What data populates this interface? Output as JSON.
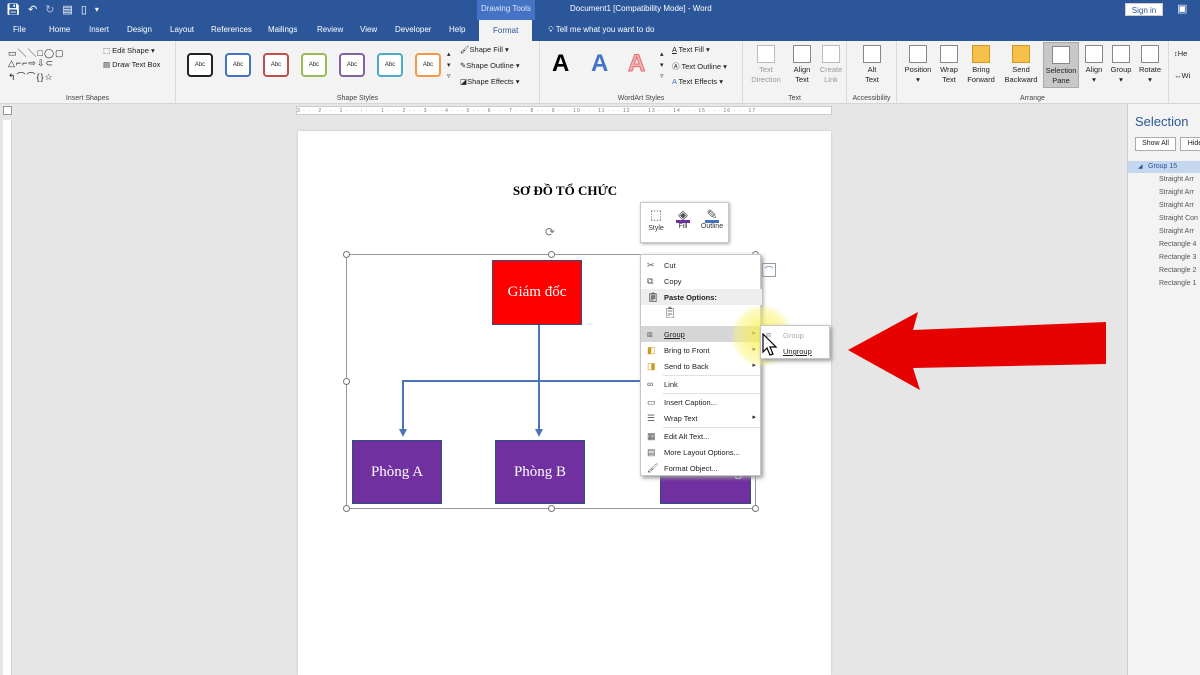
{
  "window": {
    "context_tab_group": "Drawing Tools",
    "document_title": "Document1 [Compatibility Mode]  -  Word",
    "sign_in": "Sign in"
  },
  "tabs": [
    "File",
    "Home",
    "Insert",
    "Design",
    "Layout",
    "References",
    "Mailings",
    "Review",
    "View",
    "Developer",
    "Help",
    "Format"
  ],
  "tell_me": "Tell me what you want to do",
  "ribbon": {
    "insert_shapes": {
      "label": "Insert Shapes",
      "edit_shape": "Edit Shape",
      "draw_text_box": "Draw Text Box"
    },
    "shape_styles": {
      "label": "Shape Styles",
      "sample": "Abc",
      "shape_fill": "Shape Fill",
      "shape_outline": "Shape Outline",
      "shape_effects": "Shape Effects",
      "colors": [
        "#222222",
        "#4472c4",
        "#c0504d",
        "#9bbb59",
        "#8064a2",
        "#4bacc6",
        "#f79646"
      ]
    },
    "wordart_styles": {
      "label": "WordArt Styles",
      "letter": "A",
      "text_fill": "Text Fill",
      "text_outline": "Text Outline",
      "text_effects": "Text Effects"
    },
    "text": {
      "label": "Text",
      "text_direction_1": "Text",
      "text_direction_2": "Direction",
      "align_text_1": "Align",
      "align_text_2": "Text",
      "create_link_1": "Create",
      "create_link_2": "Link"
    },
    "accessibility": {
      "label": "Accessibility",
      "alt_1": "Alt",
      "alt_2": "Text"
    },
    "arrange": {
      "label": "Arrange",
      "position": "Position",
      "wrap_1": "Wrap",
      "wrap_2": "Text",
      "bring_1": "Bring",
      "bring_2": "Forward",
      "send_1": "Send",
      "send_2": "Backward",
      "selpane_1": "Selection",
      "selpane_2": "Pane",
      "align": "Align",
      "group": "Group",
      "rotate": "Rotate"
    },
    "size_cut_1": "He",
    "size_cut_2": "Wi"
  },
  "ruler_text": "3 · · · 2 · · · 1 · · · ⁝ · · · 1 · · · 2 · · · 3 · · · 4 · · · 5 · · · 6 · · · 7 · · · 8 · · · 9 · · · 10 · · · 11 · · · 12 · · · 13 · · · 14 · · · 15 · · · 16 · · · 17",
  "document": {
    "title": "SƠ ĐỒ TỔ CHỨC",
    "director": "Giám đốc",
    "dept_a": "Phòng A",
    "dept_b": "Phòng B",
    "dept_c_partial": "g"
  },
  "mini_toolbar": {
    "style": "Style",
    "fill": "Fill",
    "outline": "Outline"
  },
  "context_menu": {
    "cut": "Cut",
    "copy": "Copy",
    "paste_options": "Paste Options:",
    "group": "Group",
    "bring_to_front": "Bring to Front",
    "send_to_back": "Send to Back",
    "link": "Link",
    "insert_caption": "Insert Caption...",
    "wrap_text": "Wrap Text",
    "edit_alt_text": "Edit Alt Text...",
    "more_layout_options": "More Layout Options...",
    "format_object": "Format Object..."
  },
  "submenu": {
    "group": "Group",
    "ungroup": "Ungroup"
  },
  "selection_pane": {
    "title": "Selection",
    "show_all": "Show All",
    "hide_all": "Hide",
    "items": [
      "Group 15",
      "Straight Arr",
      "Straight Arr",
      "Straight Arr",
      "Straight Con",
      "Straight Arr",
      "Rectangle 4",
      "Rectangle 3",
      "Rectangle 2",
      "Rectangle 1"
    ]
  },
  "colors": {
    "title_bar": "#2b579a",
    "director_box": "#ff0000",
    "dept_box": "#7030a0",
    "connector": "#4a76b8",
    "annotation_arrow": "#e60000"
  }
}
